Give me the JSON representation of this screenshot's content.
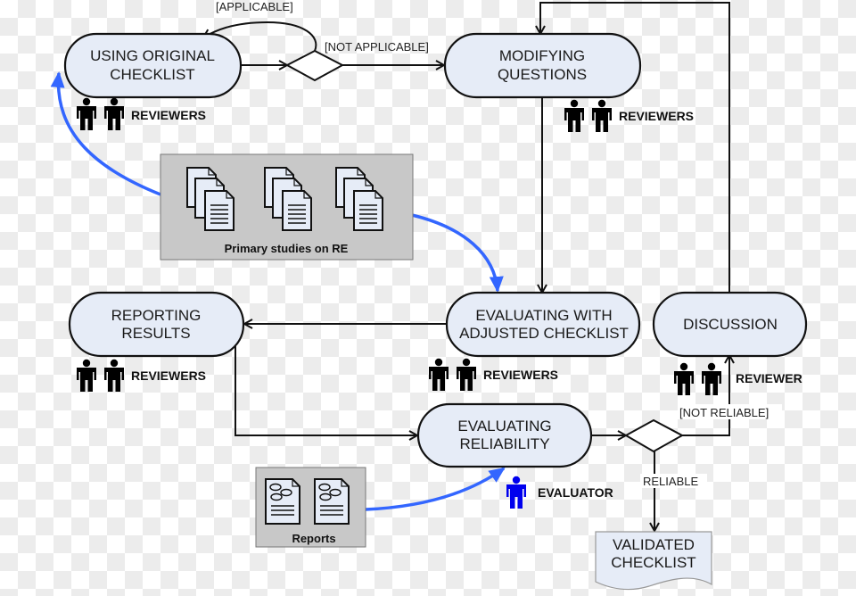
{
  "nodes": {
    "using_original": {
      "line1": "USING ORIGINAL",
      "line2": "CHECKLIST"
    },
    "modifying": {
      "line1": "MODIFYING",
      "line2": "QUESTIONS"
    },
    "reporting": {
      "line1": "REPORTING",
      "line2": "RESULTS"
    },
    "evaluating_adjusted": {
      "line1": "EVALUATING WITH",
      "line2": "ADJUSTED CHECKLIST"
    },
    "discussion": {
      "line1": "DISCUSSION"
    },
    "evaluating_reliability": {
      "line1": "EVALUATING",
      "line2": "RELIABILITY"
    },
    "validated": {
      "line1": "VALIDATED",
      "line2": "CHECKLIST"
    }
  },
  "guards": {
    "applicable": "[APPLICABLE]",
    "not_applicable": "[NOT APPLICABLE]",
    "not_reliable": "[NOT RELIABLE]",
    "reliable": "RELIABLE"
  },
  "roles": {
    "reviewers": "REVIEWERS",
    "reviewers_cut": "REVIEWER",
    "evaluator": "EVALUATOR"
  },
  "artifacts": {
    "primary_studies": "Primary studies on RE",
    "reports": "Reports"
  },
  "colors": {
    "node_fill": "#e6ecf7",
    "blue_flow": "#3366ff",
    "evaluator": "#0000ee",
    "artifact_box": "#c8c8c8"
  }
}
